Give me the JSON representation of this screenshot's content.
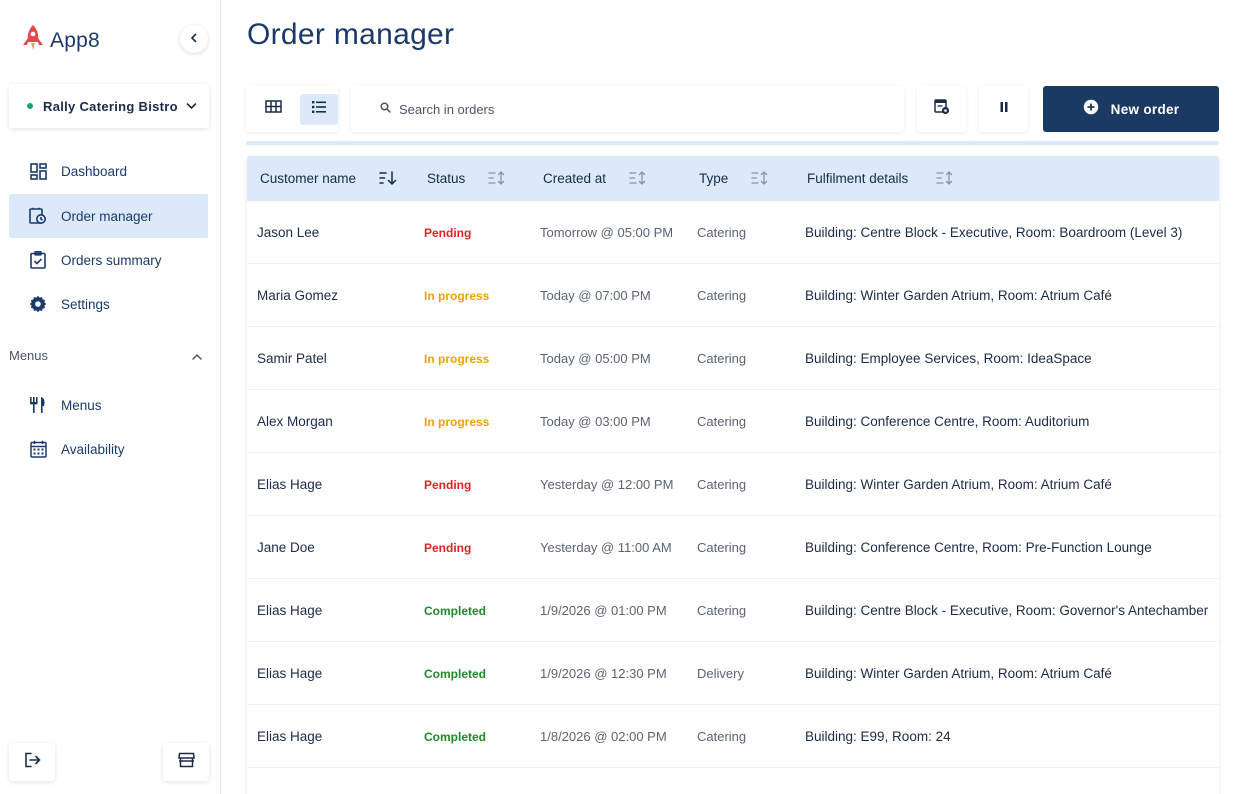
{
  "app": {
    "name": "App8"
  },
  "venue": {
    "name": "Rally Catering Bistro"
  },
  "nav": {
    "items": [
      {
        "label": "Dashboard",
        "icon": "dashboard-icon"
      },
      {
        "label": "Order manager",
        "icon": "order-manager-icon",
        "active": true
      },
      {
        "label": "Orders summary",
        "icon": "clipboard-check-icon"
      },
      {
        "label": "Settings",
        "icon": "gear-icon"
      }
    ],
    "section_label": "Menus",
    "section_items": [
      {
        "label": "Menus",
        "icon": "cutlery-icon"
      },
      {
        "label": "Availability",
        "icon": "calendar-icon"
      }
    ]
  },
  "page": {
    "title": "Order manager"
  },
  "search": {
    "placeholder": "Search in orders",
    "value": ""
  },
  "toolbar": {
    "new_order_label": "New order"
  },
  "table": {
    "columns": [
      "Customer name",
      "Status",
      "Created at",
      "Type",
      "Fulfilment details"
    ],
    "rows": [
      {
        "name": "Jason Lee",
        "status": "Pending",
        "created": "Tomorrow @ 05:00 PM",
        "type": "Catering",
        "details": "Building: Centre Block - Executive, Room: Boardroom (Level 3)"
      },
      {
        "name": "Maria Gomez",
        "status": "In progress",
        "created": "Today @ 07:00 PM",
        "type": "Catering",
        "details": "Building: Winter Garden Atrium, Room: Atrium Café"
      },
      {
        "name": "Samir Patel",
        "status": "In progress",
        "created": "Today @ 05:00 PM",
        "type": "Catering",
        "details": "Building: Employee Services, Room: IdeaSpace"
      },
      {
        "name": "Alex Morgan",
        "status": "In progress",
        "created": "Today @ 03:00 PM",
        "type": "Catering",
        "details": "Building: Conference Centre, Room: Auditorium"
      },
      {
        "name": "Elias Hage",
        "status": "Pending",
        "created": "Yesterday @ 12:00 PM",
        "type": "Catering",
        "details": "Building: Winter Garden Atrium, Room: Atrium Café"
      },
      {
        "name": "Jane Doe",
        "status": "Pending",
        "created": "Yesterday @ 11:00 AM",
        "type": "Catering",
        "details": "Building: Conference Centre, Room: Pre-Function Lounge"
      },
      {
        "name": "Elias Hage",
        "status": "Completed",
        "created": "1/9/2026 @ 01:00 PM",
        "type": "Catering",
        "details": "Building: Centre Block - Executive, Room: Governor's Antechamber"
      },
      {
        "name": "Elias Hage",
        "status": "Completed",
        "created": "1/9/2026 @ 12:30 PM",
        "type": "Delivery",
        "details": "Building: Winter Garden Atrium, Room: Atrium Café"
      },
      {
        "name": "Elias Hage",
        "status": "Completed",
        "created": "1/8/2026 @ 02:00 PM",
        "type": "Catering",
        "details": "Building: E99, Room: 24"
      }
    ]
  },
  "colors": {
    "brand_navy": "#1a3a63",
    "active_bg": "#dbe9f8",
    "status_pending": "#e02424",
    "status_in_progress": "#f2a007",
    "status_completed": "#1e8a2e",
    "venue_dot": "#17a672",
    "logo_red": "#e5484d"
  }
}
